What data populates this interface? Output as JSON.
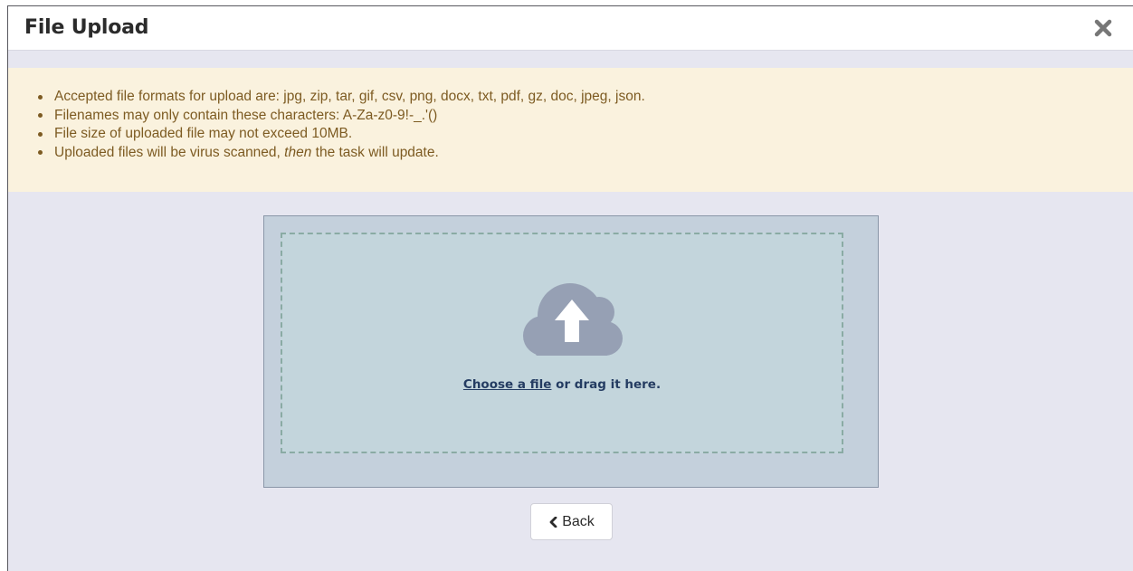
{
  "dialog": {
    "title": "File Upload",
    "close_icon": "close-icon"
  },
  "notice": {
    "items": [
      {
        "text": "Accepted file formats for upload are: jpg, zip, tar, gif, csv, png, docx, txt, pdf, gz, doc, jpeg, json."
      },
      {
        "text": "Filenames may only contain these characters: A-Za-z0-9!-_.'()"
      },
      {
        "text": "File size of uploaded file may not exceed 10MB."
      },
      {
        "text_before": "Uploaded files will be virus scanned, ",
        "text_em": "then",
        "text_after": " the task will update."
      }
    ],
    "background_color": "#faf2de",
    "text_color": "#7d5b22"
  },
  "dropzone": {
    "icon": "cloud-upload-icon",
    "link_label": "Choose a file",
    "suffix_label": " or drag it here."
  },
  "back_button": {
    "label": "Back",
    "icon": "chevron-left-icon"
  }
}
